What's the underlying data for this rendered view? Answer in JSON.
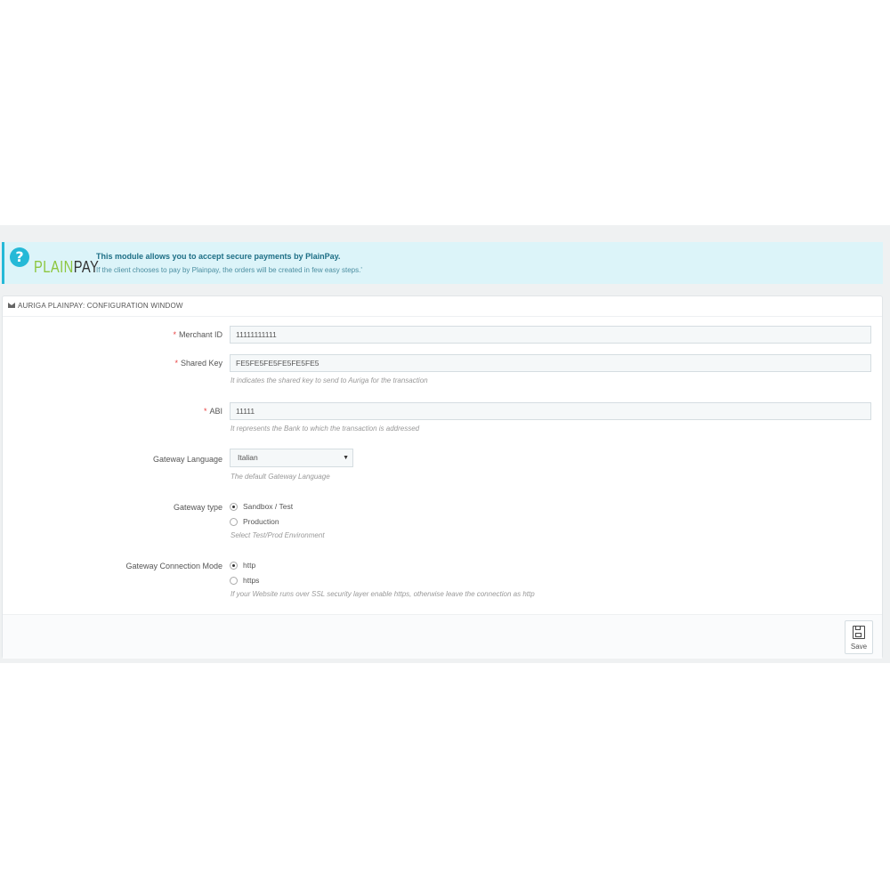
{
  "banner": {
    "logo_plain": "PLAIN",
    "logo_pay": "PAY",
    "title": "This module allows you to accept secure payments by PlainPay.",
    "subtitle": "If the client chooses to pay by Plainpay, the orders will be created in few easy steps.'"
  },
  "panel": {
    "title": "AURIGA PLAINPAY: CONFIGURATION WINDOW"
  },
  "form": {
    "required_mark": "*",
    "merchant_id": {
      "label": "Merchant ID",
      "value": "11111111111"
    },
    "shared_key": {
      "label": "Shared Key",
      "value": "FE5FE5FE5FE5FE5FE5",
      "help": "It indicates the shared key to send to Auriga for the transaction"
    },
    "abi": {
      "label": "ABI",
      "value": "11111",
      "help": "It represents the Bank to which the transaction is addressed"
    },
    "gateway_language": {
      "label": "Gateway Language",
      "selected": "Italian",
      "help": "The default Gateway Language"
    },
    "gateway_type": {
      "label": "Gateway type",
      "option1": "Sandbox / Test",
      "option2": "Production",
      "selected": "Sandbox / Test",
      "help": "Select Test/Prod Environment"
    },
    "connection_mode": {
      "label": "Gateway Connection Mode",
      "option1": "http",
      "option2": "https",
      "selected": "http",
      "help": "If your Website runs over SSL security layer enable https, otherwise leave the connection as http"
    }
  },
  "footer": {
    "save_label": "Save"
  }
}
